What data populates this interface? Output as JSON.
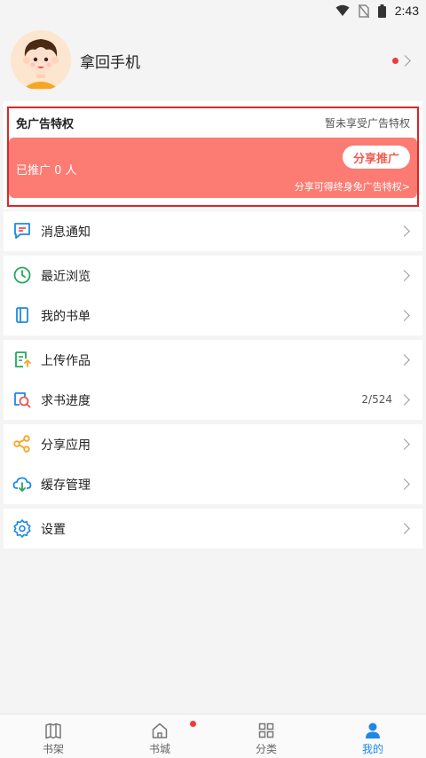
{
  "status_bar": {
    "time": "2:43"
  },
  "profile": {
    "name": "拿回手机"
  },
  "ad_free": {
    "title": "免广告特权",
    "status": "暂未享受广告特权",
    "promo_count": "已推广 0 人",
    "share_button": "分享推广",
    "hint": "分享可得终身免广告特权>"
  },
  "menu": {
    "notifications": "消息通知",
    "recent": "最近浏览",
    "booklist": "我的书单",
    "upload": "上传作品",
    "request": "求书进度",
    "request_progress": "2/524",
    "share_app": "分享应用",
    "cache": "缓存管理",
    "settings": "设置"
  },
  "nav": {
    "bookshelf": "书架",
    "bookstore": "书城",
    "category": "分类",
    "mine": "我的"
  },
  "colors": {
    "accent_blue": "#1e88e5",
    "promo_red": "#fc7b72",
    "highlight_outline": "#e02424"
  }
}
